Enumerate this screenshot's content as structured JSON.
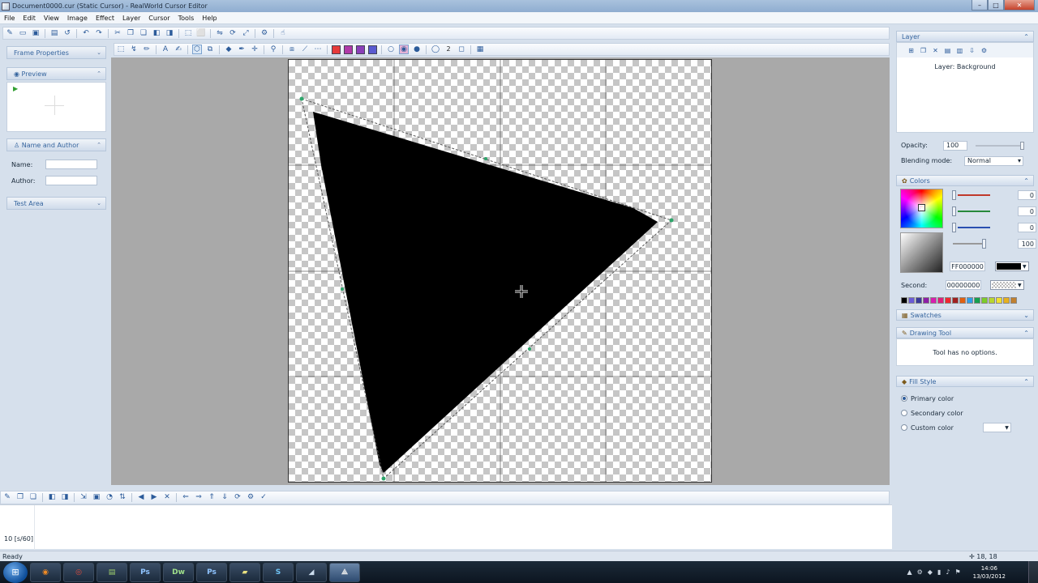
{
  "window": {
    "title": "Document0000.cur (Static Cursor) - RealWorld Cursor Editor"
  },
  "menu": [
    "File",
    "Edit",
    "View",
    "Image",
    "Effect",
    "Layer",
    "Cursor",
    "Tools",
    "Help"
  ],
  "left_panel": {
    "frame_properties": "Frame Properties",
    "preview": "Preview",
    "name_author": "Name and Author",
    "name_label": "Name:",
    "author_label": "Author:",
    "name_value": "",
    "author_value": "",
    "test_area": "Test Area"
  },
  "toolbar": {
    "brush_size": "2"
  },
  "timeline": {
    "frame_label": "10 [s/60]"
  },
  "status": {
    "text": "Ready",
    "coords": "18, 18"
  },
  "right_panel": {
    "layer_header": "Layer",
    "layer_name": "Layer: Background",
    "opacity_label": "Opacity:",
    "opacity_value": "100",
    "blending_label": "Blending mode:",
    "blending_value": "Normal",
    "colors_header": "Colors",
    "channels": [
      {
        "color": "#c0392b",
        "value": "0"
      },
      {
        "color": "#27893b",
        "value": "0"
      },
      {
        "color": "#2a4fb0",
        "value": "0"
      },
      {
        "color": "#888888",
        "value": "100"
      }
    ],
    "primary_hex": "FF000000",
    "second_label": "Second:",
    "second_hex": "00000000",
    "palette": [
      "#000000",
      "#6b5bd6",
      "#3b3b9b",
      "#8e1fa8",
      "#d81fb0",
      "#e0207a",
      "#f0282f",
      "#a02020",
      "#e06010",
      "#2d9ee8",
      "#15a050",
      "#7ccc2a",
      "#b8d630",
      "#f0e030",
      "#e6b020",
      "#c08030"
    ],
    "swatches_header": "Swatches",
    "drawing_tool_header": "Drawing Tool",
    "drawing_tool_msg": "Tool has no options.",
    "fill_style_header": "Fill Style",
    "fill_options": [
      "Primary color",
      "Secondary color",
      "Custom color"
    ]
  },
  "taskbar": {
    "apps": [
      "Firefox",
      "Chrome",
      "Explorer",
      "Ps",
      "Dw",
      "Ps",
      "Notes",
      "Skype",
      "Editor",
      "Cursor"
    ],
    "time": "14:06",
    "date": "13/03/2012"
  }
}
